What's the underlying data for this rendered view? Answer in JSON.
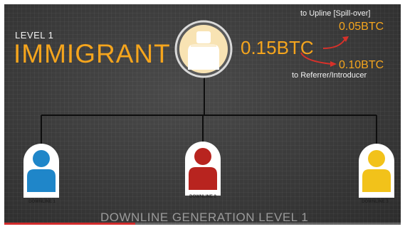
{
  "header": {
    "level_label": "LEVEL 1",
    "rank_title": "IMMIGRANT"
  },
  "payout": {
    "total_amount": "0.15BTC",
    "upline_label": "to Upline [Spill-over]",
    "upline_amount": "0.05BTC",
    "referrer_amount": "0.10BTC",
    "referrer_label": "to Referrer/Introducer"
  },
  "downlines": [
    {
      "label": "DOWNLINE 1",
      "color": "#1f86c9"
    },
    {
      "label": "DOWNLINE 2",
      "color": "#b8241f"
    },
    {
      "label": "DOWNLINE 3",
      "color": "#f2c21a"
    }
  ],
  "footer": {
    "generation_label": "DOWNLINE GENERATION LEVEL 1"
  },
  "video": {
    "progress": 0.33
  },
  "colors": {
    "accent_orange": "#f5a51d",
    "arrow_red": "#d8312a",
    "progress_red": "#d12b2b"
  },
  "icons": {
    "member_avatar": "person-silhouette-icon"
  }
}
